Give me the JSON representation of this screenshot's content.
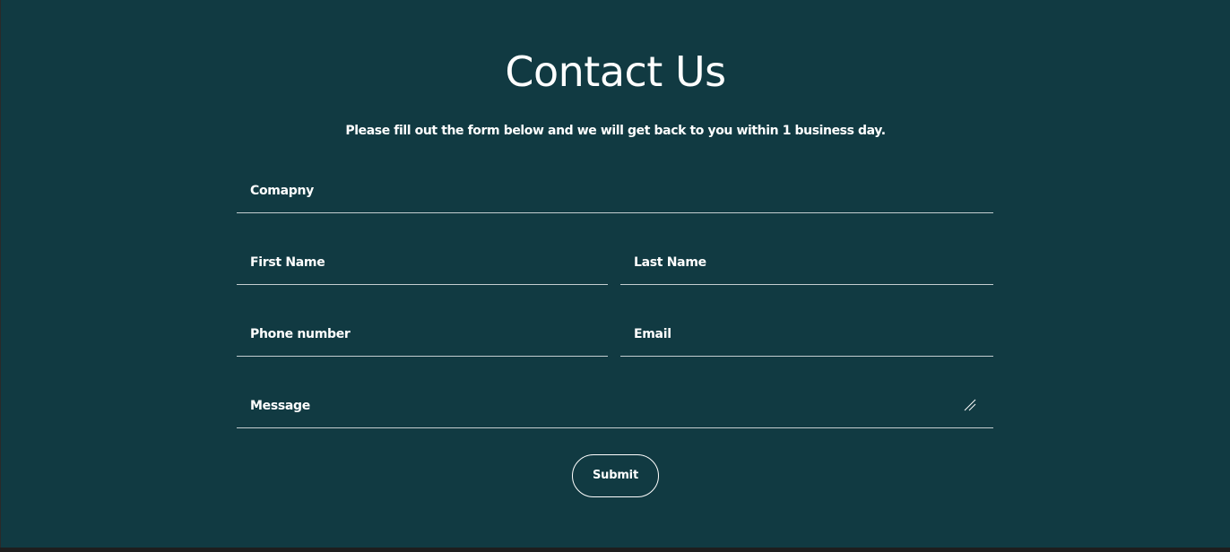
{
  "contact": {
    "title": "Contact Us",
    "subtitle": "Please fill out the form below and we will get back to you within 1 business day."
  },
  "form": {
    "company_label": "Comapny",
    "first_name_label": "First Name",
    "last_name_label": "Last Name",
    "phone_label": "Phone number",
    "email_label": "Email",
    "message_label": "Message",
    "submit_label": "Submit"
  },
  "colors": {
    "background": "#113a42",
    "text": "#ffffff",
    "underline": "#c4ced0"
  },
  "icons": {
    "textarea_resize": "resize-handle-icon"
  }
}
